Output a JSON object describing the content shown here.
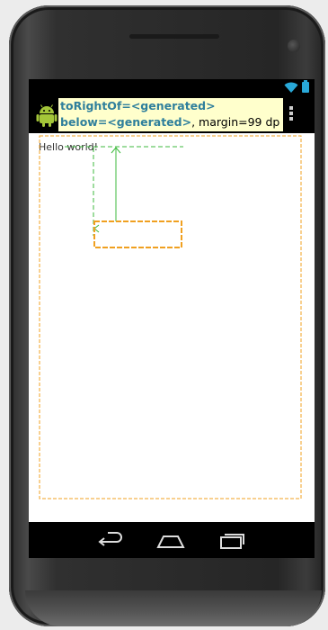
{
  "tooltip": {
    "to_right_of": "toRightOf=<generated>",
    "below": "below=<generated>",
    "margin": ", margin=99 dp"
  },
  "content": {
    "hello_text": "Hello world!"
  },
  "icons": {
    "app": "android-robot-icon",
    "wifi": "wifi-icon",
    "battery": "battery-icon",
    "overflow": "overflow-menu-icon",
    "back": "back-icon",
    "home": "home-icon",
    "recents": "recent-apps-icon"
  },
  "colors": {
    "tooltip_bg": "#ffffcc",
    "attr_text": "#2f7f9c",
    "guide_orange": "#f0a020",
    "guide_green": "#3cba3c",
    "status_accent": "#29a8d8",
    "android_green": "#a4c639"
  }
}
